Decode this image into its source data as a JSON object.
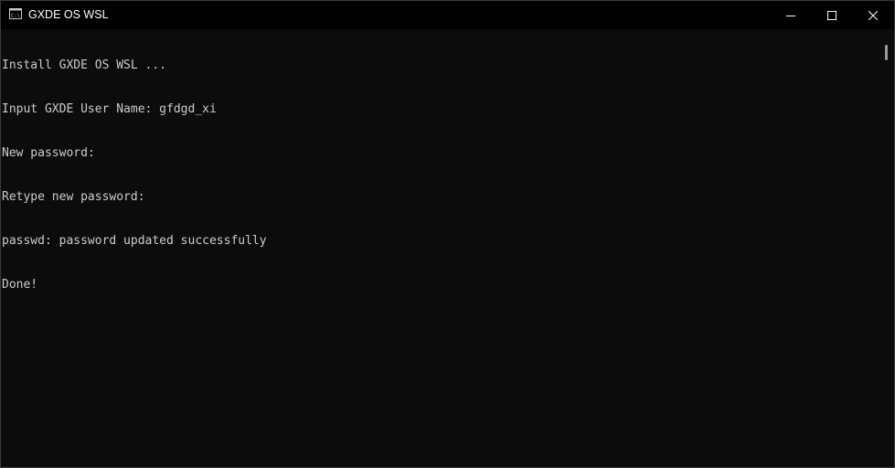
{
  "window": {
    "title": "GXDE OS WSL",
    "icon": "console-icon"
  },
  "caption_buttons": {
    "minimize": "minimize-icon",
    "maximize": "maximize-icon",
    "close": "close-icon"
  },
  "console": {
    "lines": [
      "Install GXDE OS WSL ...",
      "Input GXDE User Name: gfdgd_xi",
      "New password:",
      "Retype new password:",
      "passwd: password updated successfully",
      "Done!"
    ],
    "text_color": "#cccccc",
    "background_color": "#0c0c0c"
  }
}
